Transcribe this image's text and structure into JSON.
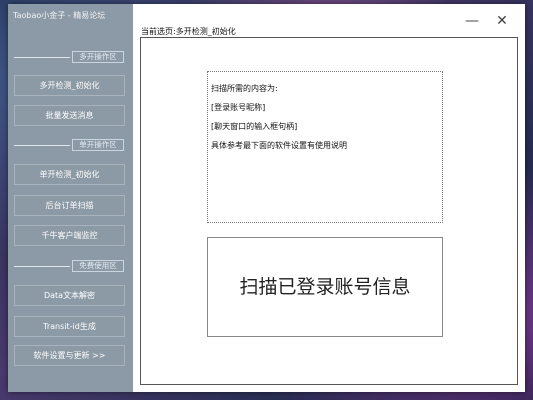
{
  "app": {
    "title": "Taobao小金子 - 精易论坛"
  },
  "sidebar": {
    "sections": [
      {
        "label": "多开操作区"
      },
      {
        "label": "单开操作区"
      },
      {
        "label": "免费使用区"
      }
    ],
    "buttons": [
      {
        "label": "多开检测_初始化"
      },
      {
        "label": "批量发送消息"
      },
      {
        "label": "单开检测_初始化"
      },
      {
        "label": "后台订单扫描"
      },
      {
        "label": "千牛客户端监控"
      },
      {
        "label": "Data文本解密"
      },
      {
        "label": "Transit-id生成"
      },
      {
        "label": "软件设置与更新 >>"
      }
    ]
  },
  "window_controls": {
    "minimize": "—",
    "close": "✕"
  },
  "main": {
    "current_page": "当前选页:多开检测_初始化",
    "info_lines": [
      "扫描所需的内容为:",
      "[登录账号昵称]",
      "[聊天窗口的输入框句柄]",
      "具体参考最下面的软件设置有使用说明"
    ],
    "scan_button": "扫描已登录账号信息"
  }
}
